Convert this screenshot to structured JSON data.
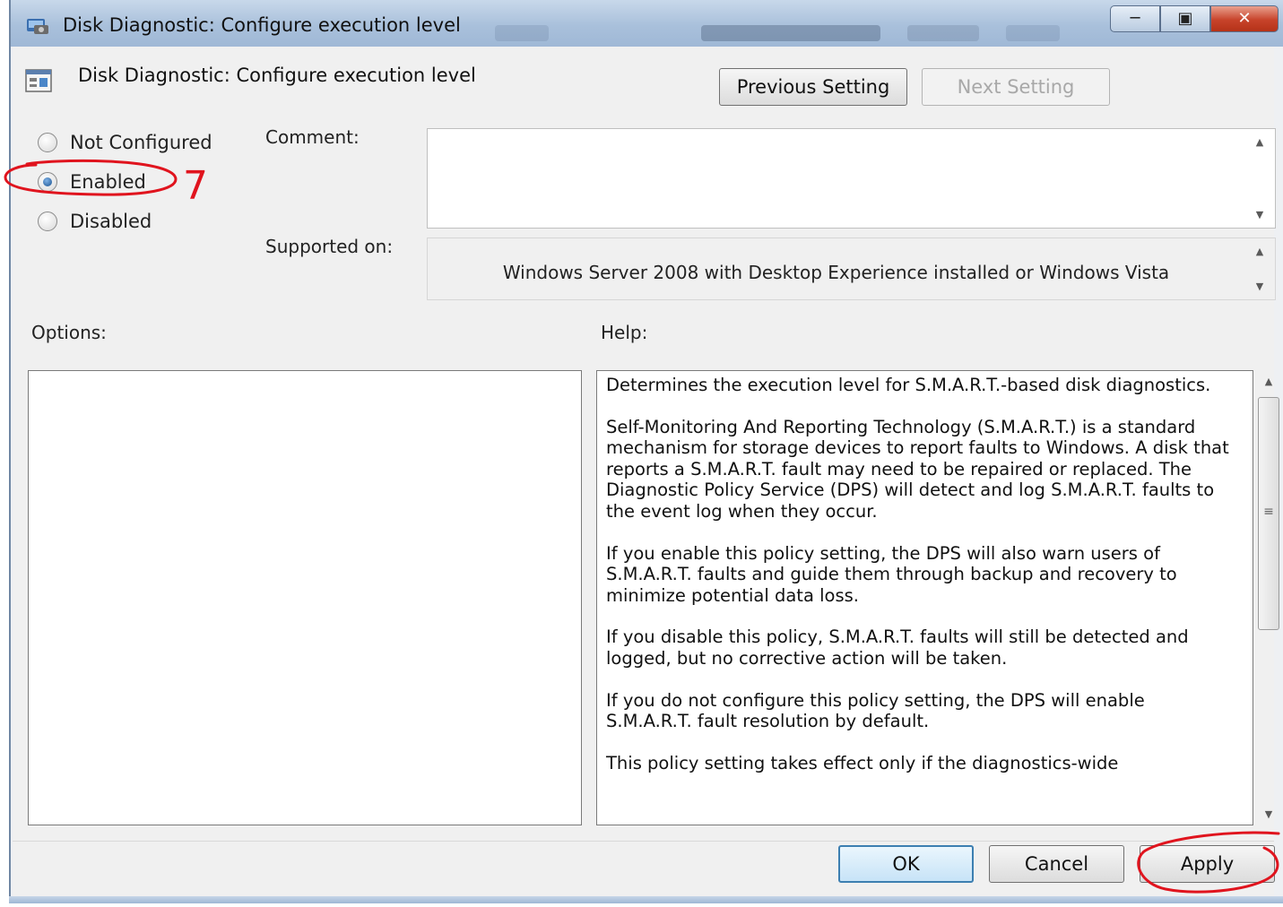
{
  "window": {
    "title": "Disk Diagnostic: Configure execution level",
    "icons": {
      "title": "disk-diagnostic-icon",
      "minimize": "minimize-icon",
      "maximize": "maximize-icon",
      "close": "close-icon"
    }
  },
  "header": {
    "setting_name": "Disk Diagnostic: Configure execution level",
    "setting_icon": "policy-setting-icon",
    "previous_label": "Previous Setting",
    "next_label": "Next Setting"
  },
  "state": {
    "options": [
      {
        "label": "Not Configured",
        "checked": false
      },
      {
        "label": "Enabled",
        "checked": true
      },
      {
        "label": "Disabled",
        "checked": false
      }
    ]
  },
  "comment": {
    "label": "Comment:",
    "value": ""
  },
  "supported": {
    "label": "Supported on:",
    "value": "Windows Server 2008 with Desktop Experience installed or Windows Vista"
  },
  "options_label": "Options:",
  "help": {
    "label": "Help:",
    "paragraphs": [
      "Determines the execution level for S.M.A.R.T.-based disk diagnostics.",
      "Self-Monitoring And Reporting Technology (S.M.A.R.T.) is a standard mechanism for storage devices to report faults to Windows.  A disk that reports a S.M.A.R.T. fault may need to be repaired or replaced.  The Diagnostic Policy Service (DPS) will detect and log S.M.A.R.T. faults to the event log when they occur.",
      "If you enable this policy setting, the DPS will also warn users of S.M.A.R.T. faults and guide them through backup and recovery to minimize potential data loss.",
      "If you disable this policy, S.M.A.R.T. faults will still be detected and logged, but no corrective action will be taken.",
      "If you do not configure this policy setting, the DPS will enable S.M.A.R.T. fault resolution by default.",
      "This policy setting takes effect only if the diagnostics-wide"
    ]
  },
  "footer": {
    "ok_label": "OK",
    "cancel_label": "Cancel",
    "apply_label": "Apply"
  },
  "annotation": {
    "mark": "7",
    "color": "#e0141e"
  }
}
